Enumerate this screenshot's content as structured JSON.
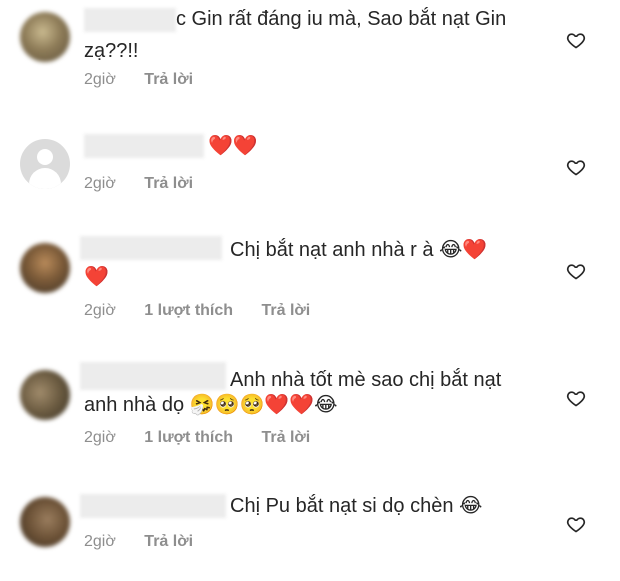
{
  "comments": [
    {
      "text_line1": "c Gin rất đáng iu mà, Sao bắt nạt Gin",
      "text_line2": "zạ??!!",
      "time": "2giờ",
      "reply": "Trả lời",
      "likes": ""
    },
    {
      "text_line1": "❤️❤️",
      "text_line2": "",
      "time": "2giờ",
      "reply": "Trả lời",
      "likes": ""
    },
    {
      "text_line1": "Chị bắt nạt anh nhà r à 😂❤️",
      "text_line2": "❤️",
      "time": "2giờ",
      "reply": "Trả lời",
      "likes": "1 lượt thích"
    },
    {
      "text_line1": "Anh nhà tốt mè sao chị bắt nạt",
      "text_line2": "anh nhà dọ 🤧🥺🥺❤️❤️😂",
      "time": "2giờ",
      "reply": "Trả lời",
      "likes": "1 lượt thích"
    },
    {
      "text_line1": "Chị Pu bắt nạt si dọ chèn 😂",
      "text_line2": "",
      "time": "2giờ",
      "reply": "Trả lời",
      "likes": ""
    }
  ],
  "icons": {
    "like": "heart-outline-icon"
  },
  "colors": {
    "text": "#262626",
    "meta": "#8e8e8e"
  }
}
